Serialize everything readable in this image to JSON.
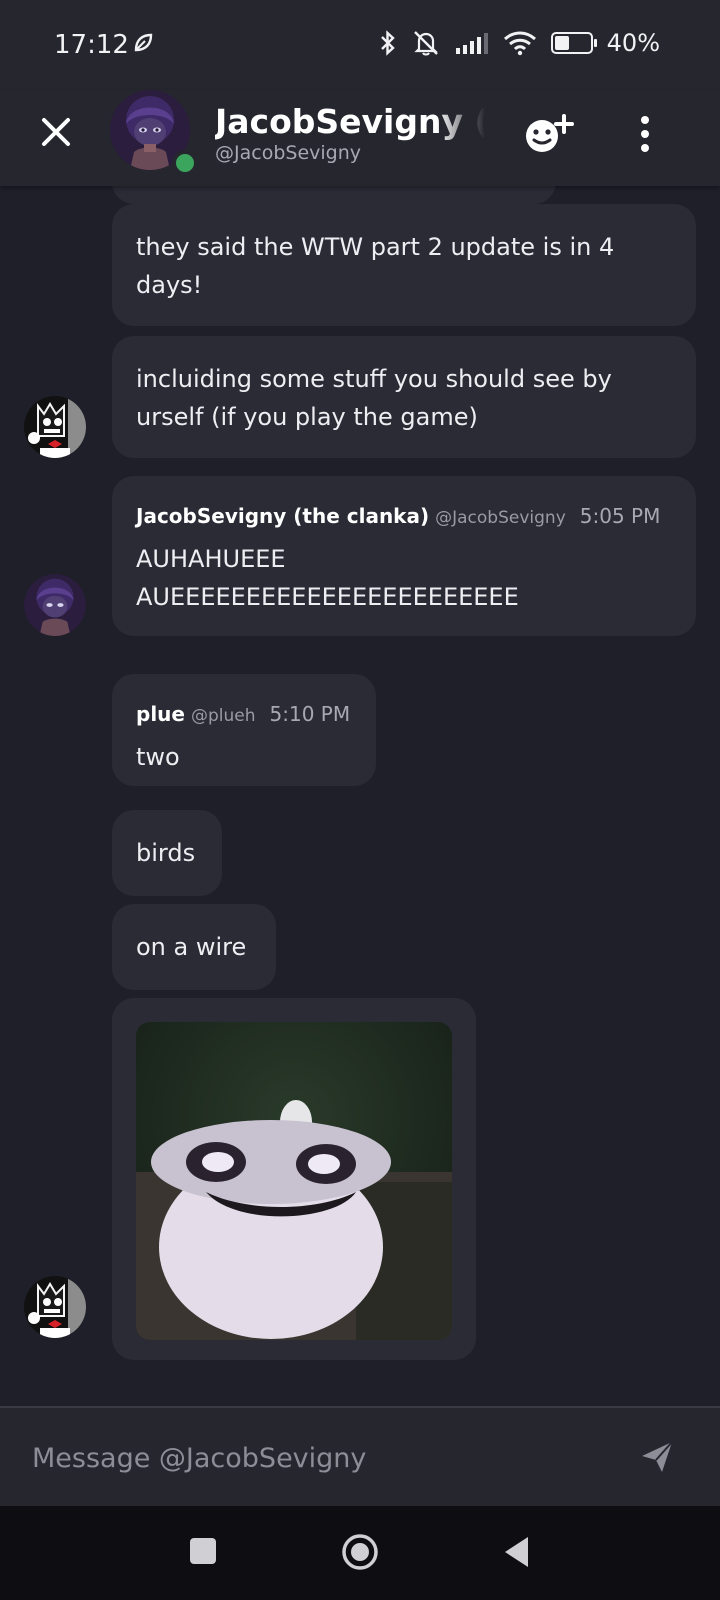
{
  "status_bar": {
    "time": "17:12",
    "battery": "40%"
  },
  "header": {
    "name": "JacobSevigny (the clanka)",
    "handle": "@JacobSevigny"
  },
  "messages": [
    {
      "text": "they said the WTW part 2 update is in 4 days!"
    },
    {
      "text": "incluiding some stuff you should see by urself (if you play the game)"
    },
    {
      "author": "JacobSevigny (the clanka)",
      "handle": "@JacobSevigny",
      "time": "5:05 PM",
      "text": "AUHAHUEEE AUEEEEEEEEEEEEEEEEEEEEEEE"
    },
    {
      "author": "plue",
      "handle": "@plueh",
      "time": "5:10 PM",
      "text": "two"
    },
    {
      "text": "birds"
    },
    {
      "text": "on a wire"
    }
  ],
  "composer": {
    "placeholder": "Message @JacobSevigny"
  },
  "colors": {
    "background": "#1f1f29",
    "bubble": "#2b2b36",
    "online": "#3ba55d"
  }
}
